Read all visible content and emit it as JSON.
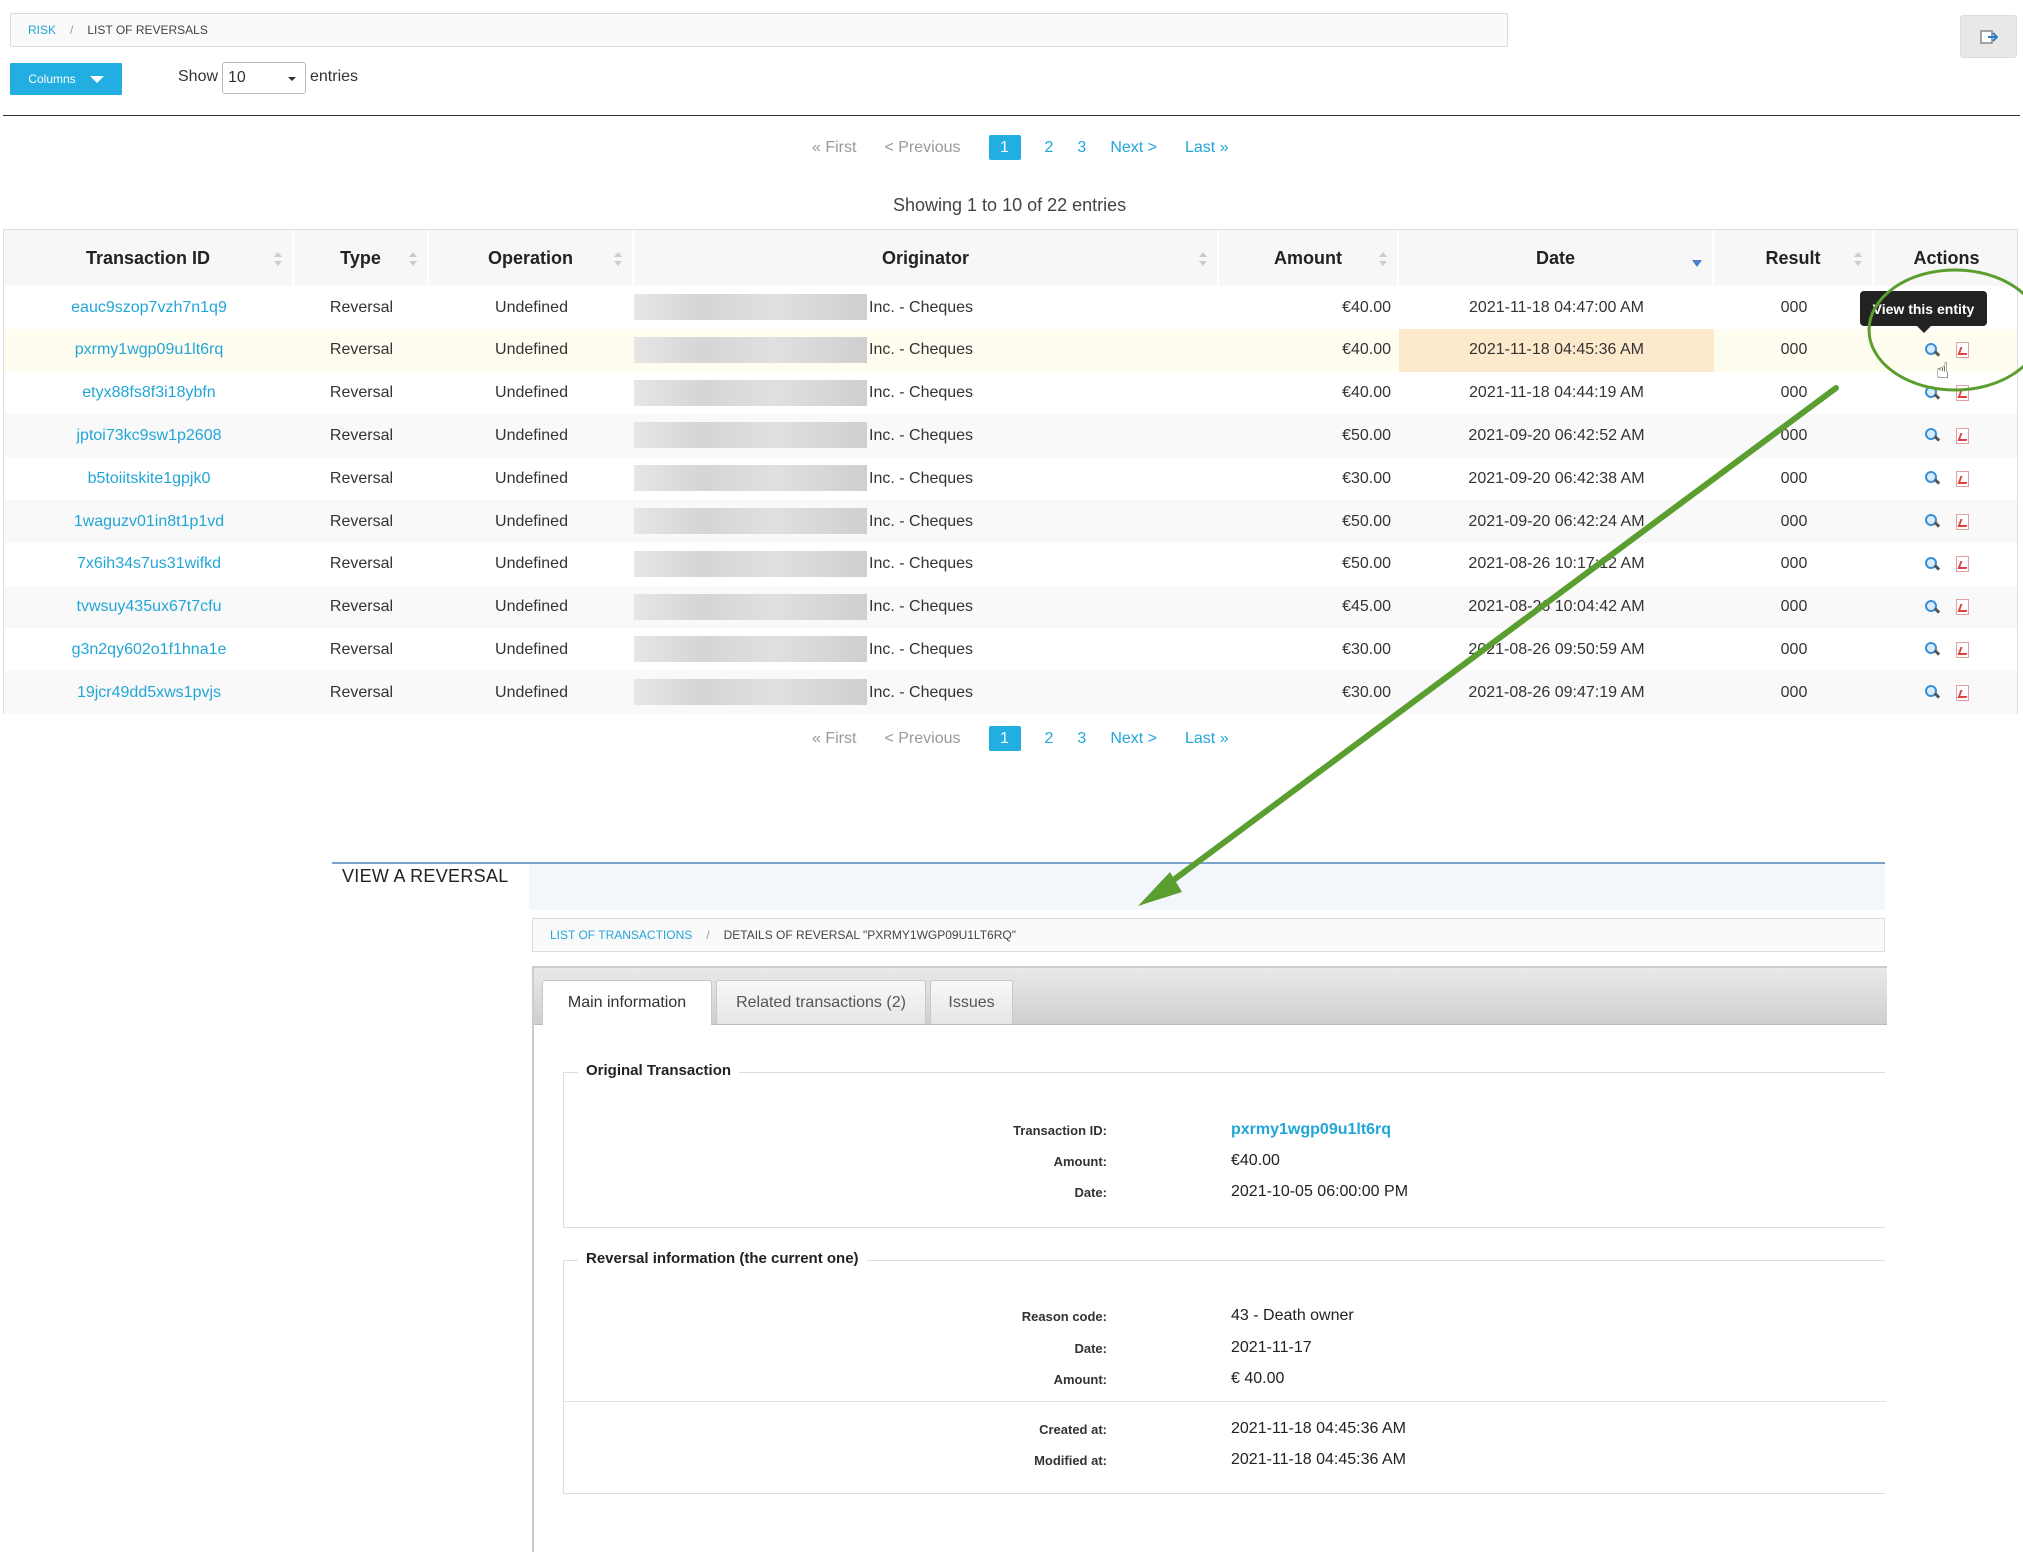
{
  "breadcrumb": {
    "parent": "RISK",
    "current": "LIST OF REVERSALS"
  },
  "toolbar": {
    "columns_label": "Columns",
    "show_label": "Show",
    "page_size": "10",
    "entries_label": "entries"
  },
  "pagination": {
    "first": "« First",
    "previous": "< Previous",
    "pages": [
      "1",
      "2",
      "3"
    ],
    "active_page": "1",
    "next": "Next >",
    "last": "Last »"
  },
  "showing_text": "Showing 1 to 10 of 22 entries",
  "table": {
    "headers": [
      "Transaction ID",
      "Type",
      "Operation",
      "Originator",
      "Amount",
      "Date",
      "Result",
      "Actions"
    ],
    "rows": [
      {
        "id": "eauc9szop7vzh7n1q9",
        "type": "Reversal",
        "operation": "Undefined",
        "originator": "Inc. - Cheques",
        "amount": "€40.00",
        "date": "2021-11-18 04:47:00 AM",
        "result": "000"
      },
      {
        "id": "pxrmy1wgp09u1lt6rq",
        "type": "Reversal",
        "operation": "Undefined",
        "originator": "Inc. - Cheques",
        "amount": "€40.00",
        "date": "2021-11-18 04:45:36 AM",
        "result": "000"
      },
      {
        "id": "etyx88fs8f3i18ybfn",
        "type": "Reversal",
        "operation": "Undefined",
        "originator": "Inc. - Cheques",
        "amount": "€40.00",
        "date": "2021-11-18 04:44:19 AM",
        "result": "000"
      },
      {
        "id": "jptoi73kc9sw1p2608",
        "type": "Reversal",
        "operation": "Undefined",
        "originator": "Inc. - Cheques",
        "amount": "€50.00",
        "date": "2021-09-20 06:42:52 AM",
        "result": "000"
      },
      {
        "id": "b5toiitskite1gpjk0",
        "type": "Reversal",
        "operation": "Undefined",
        "originator": "Inc. - Cheques",
        "amount": "€30.00",
        "date": "2021-09-20 06:42:38 AM",
        "result": "000"
      },
      {
        "id": "1waguzv01in8t1p1vd",
        "type": "Reversal",
        "operation": "Undefined",
        "originator": "Inc. - Cheques",
        "amount": "€50.00",
        "date": "2021-09-20 06:42:24 AM",
        "result": "000"
      },
      {
        "id": "7x6ih34s7us31wifkd",
        "type": "Reversal",
        "operation": "Undefined",
        "originator": "Inc. - Cheques",
        "amount": "€50.00",
        "date": "2021-08-26 10:17:12 AM",
        "result": "000"
      },
      {
        "id": "tvwsuy435ux67t7cfu",
        "type": "Reversal",
        "operation": "Undefined",
        "originator": "Inc. - Cheques",
        "amount": "€45.00",
        "date": "2021-08-26 10:04:42 AM",
        "result": "000"
      },
      {
        "id": "g3n2qy602o1f1hna1e",
        "type": "Reversal",
        "operation": "Undefined",
        "originator": "Inc. - Cheques",
        "amount": "€30.00",
        "date": "2021-08-26 09:50:59 AM",
        "result": "000"
      },
      {
        "id": "19jcr49dd5xws1pvjs",
        "type": "Reversal",
        "operation": "Undefined",
        "originator": "Inc. - Cheques",
        "amount": "€30.00",
        "date": "2021-08-26 09:47:19 AM",
        "result": "000"
      }
    ]
  },
  "tooltip": "View this entity",
  "icons": {
    "view": "magnifier-icon",
    "pdf": "pdf-icon",
    "logout": "exit-icon",
    "cursor": "hand-pointer-icon"
  },
  "colors": {
    "accent": "#22aee0",
    "link": "#22a6d8",
    "annotation": "#5a9e2f",
    "hover_row": "#fffdef",
    "date_highlight": "#fde9cc"
  },
  "detail": {
    "title": "VIEW A REVERSAL",
    "breadcrumb": {
      "parent": "LIST OF TRANSACTIONS",
      "current": "DETAILS OF REVERSAL \"PXRMY1WGP09U1LT6RQ\""
    },
    "tabs": [
      "Main information",
      "Related transactions (2)",
      "Issues"
    ],
    "original": {
      "legend": "Original Transaction",
      "transaction_id_label": "Transaction ID:",
      "transaction_id": "pxrmy1wgp09u1lt6rq",
      "amount_label": "Amount:",
      "amount": "€40.00",
      "date_label": "Date:",
      "date": "2021-10-05 06:00:00 PM"
    },
    "reversal": {
      "legend": "Reversal information (the current one)",
      "reason_label": "Reason code:",
      "reason": "43 - Death owner",
      "date_label": "Date:",
      "date": "2021-11-17",
      "amount_label": "Amount:",
      "amount": "€ 40.00",
      "created_label": "Created at:",
      "created": "2021-11-18 04:45:36 AM",
      "modified_label": "Modified at:",
      "modified": "2021-11-18 04:45:36 AM"
    }
  }
}
